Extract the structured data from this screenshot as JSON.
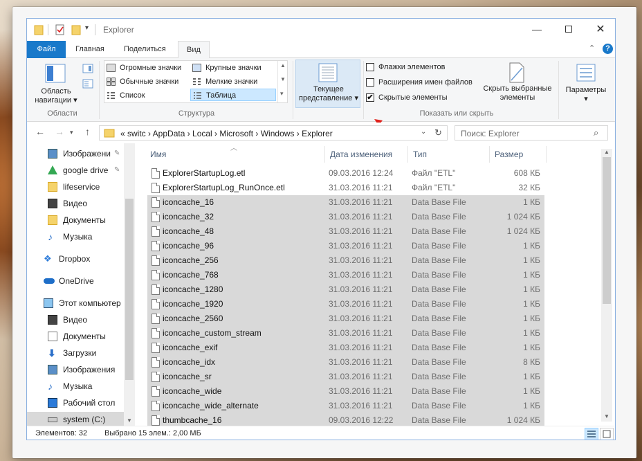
{
  "window": {
    "title": "Explorer"
  },
  "tabs": [
    "Файл",
    "Главная",
    "Поделиться",
    "Вид"
  ],
  "ribbon": {
    "panes": {
      "nav_label": "Область навигации",
      "group": "Области"
    },
    "layout": {
      "items": [
        "Огромные значки",
        "Крупные значки",
        "Обычные значки",
        "Мелкие значки",
        "Список",
        "Таблица"
      ],
      "group": "Структура"
    },
    "current_view": {
      "label": "Текущее представление"
    },
    "show_hide": {
      "checkboxes": [
        {
          "label": "Флажки элементов",
          "checked": ""
        },
        {
          "label": "Расширения имен файлов",
          "checked": ""
        },
        {
          "label": "Скрытые элементы",
          "checked": "✔"
        }
      ],
      "hide_selected": "Скрыть выбранные элементы",
      "group": "Показать или скрыть"
    },
    "options": {
      "label": "Параметры"
    }
  },
  "address": {
    "crumbs": "«   switc  ›  AppData  ›  Local  ›  Microsoft  ›  Windows  ›  Explorer",
    "search_placeholder": "Поиск: Explorer"
  },
  "nav": [
    {
      "label": "Изображени",
      "icon": "pictures-icon"
    },
    {
      "label": "google drive",
      "icon": "google-drive-icon"
    },
    {
      "label": "lifeservice",
      "icon": "folder-icon"
    },
    {
      "label": "Видео",
      "icon": "video-icon"
    },
    {
      "label": "Документы",
      "icon": "folder-icon"
    },
    {
      "label": "Музыка",
      "icon": "music-icon"
    },
    {
      "label": "Dropbox",
      "icon": "dropbox-icon"
    },
    {
      "label": "OneDrive",
      "icon": "onedrive-icon"
    },
    {
      "label": "Этот компьютер",
      "icon": "computer-icon"
    },
    {
      "label": "Видео",
      "icon": "video-icon"
    },
    {
      "label": "Документы",
      "icon": "documents-icon"
    },
    {
      "label": "Загрузки",
      "icon": "downloads-icon"
    },
    {
      "label": "Изображения",
      "icon": "pictures-icon"
    },
    {
      "label": "Музыка",
      "icon": "music-icon"
    },
    {
      "label": "Рабочий стол",
      "icon": "desktop-icon"
    },
    {
      "label": "system (C:)",
      "icon": "drive-icon"
    }
  ],
  "columns": {
    "name": "Имя",
    "date": "Дата изменения",
    "type": "Тип",
    "size": "Размер"
  },
  "files": [
    {
      "name": "ExplorerStartupLog.etl",
      "date": "09.03.2016 12:24",
      "type": "Файл \"ETL\"",
      "size": "608 КБ",
      "selected": false
    },
    {
      "name": "ExplorerStartupLog_RunOnce.etl",
      "date": "31.03.2016 11:21",
      "type": "Файл \"ETL\"",
      "size": "32 КБ",
      "selected": false
    },
    {
      "name": "iconcache_16",
      "date": "31.03.2016 11:21",
      "type": "Data Base File",
      "size": "1 КБ",
      "selected": true
    },
    {
      "name": "iconcache_32",
      "date": "31.03.2016 11:21",
      "type": "Data Base File",
      "size": "1 024 КБ",
      "selected": true
    },
    {
      "name": "iconcache_48",
      "date": "31.03.2016 11:21",
      "type": "Data Base File",
      "size": "1 024 КБ",
      "selected": true
    },
    {
      "name": "iconcache_96",
      "date": "31.03.2016 11:21",
      "type": "Data Base File",
      "size": "1 КБ",
      "selected": true
    },
    {
      "name": "iconcache_256",
      "date": "31.03.2016 11:21",
      "type": "Data Base File",
      "size": "1 КБ",
      "selected": true
    },
    {
      "name": "iconcache_768",
      "date": "31.03.2016 11:21",
      "type": "Data Base File",
      "size": "1 КБ",
      "selected": true
    },
    {
      "name": "iconcache_1280",
      "date": "31.03.2016 11:21",
      "type": "Data Base File",
      "size": "1 КБ",
      "selected": true
    },
    {
      "name": "iconcache_1920",
      "date": "31.03.2016 11:21",
      "type": "Data Base File",
      "size": "1 КБ",
      "selected": true
    },
    {
      "name": "iconcache_2560",
      "date": "31.03.2016 11:21",
      "type": "Data Base File",
      "size": "1 КБ",
      "selected": true
    },
    {
      "name": "iconcache_custom_stream",
      "date": "31.03.2016 11:21",
      "type": "Data Base File",
      "size": "1 КБ",
      "selected": true
    },
    {
      "name": "iconcache_exif",
      "date": "31.03.2016 11:21",
      "type": "Data Base File",
      "size": "1 КБ",
      "selected": true
    },
    {
      "name": "iconcache_idx",
      "date": "31.03.2016 11:21",
      "type": "Data Base File",
      "size": "8 КБ",
      "selected": true
    },
    {
      "name": "iconcache_sr",
      "date": "31.03.2016 11:21",
      "type": "Data Base File",
      "size": "1 КБ",
      "selected": true
    },
    {
      "name": "iconcache_wide",
      "date": "31.03.2016 11:21",
      "type": "Data Base File",
      "size": "1 КБ",
      "selected": true
    },
    {
      "name": "iconcache_wide_alternate",
      "date": "31.03.2016 11:21",
      "type": "Data Base File",
      "size": "1 КБ",
      "selected": true
    },
    {
      "name": "thumbcache_16",
      "date": "09.03.2016 12:22",
      "type": "Data Base File",
      "size": "1 024 КБ",
      "selected": true
    }
  ],
  "status": {
    "items": "Элементов: 32",
    "selected": "Выбрано 15 элем.: 2,00 МБ"
  },
  "colors": {
    "accent": "#1979ca",
    "selection": "#d9d9d9",
    "arrow": "#e0201a"
  }
}
